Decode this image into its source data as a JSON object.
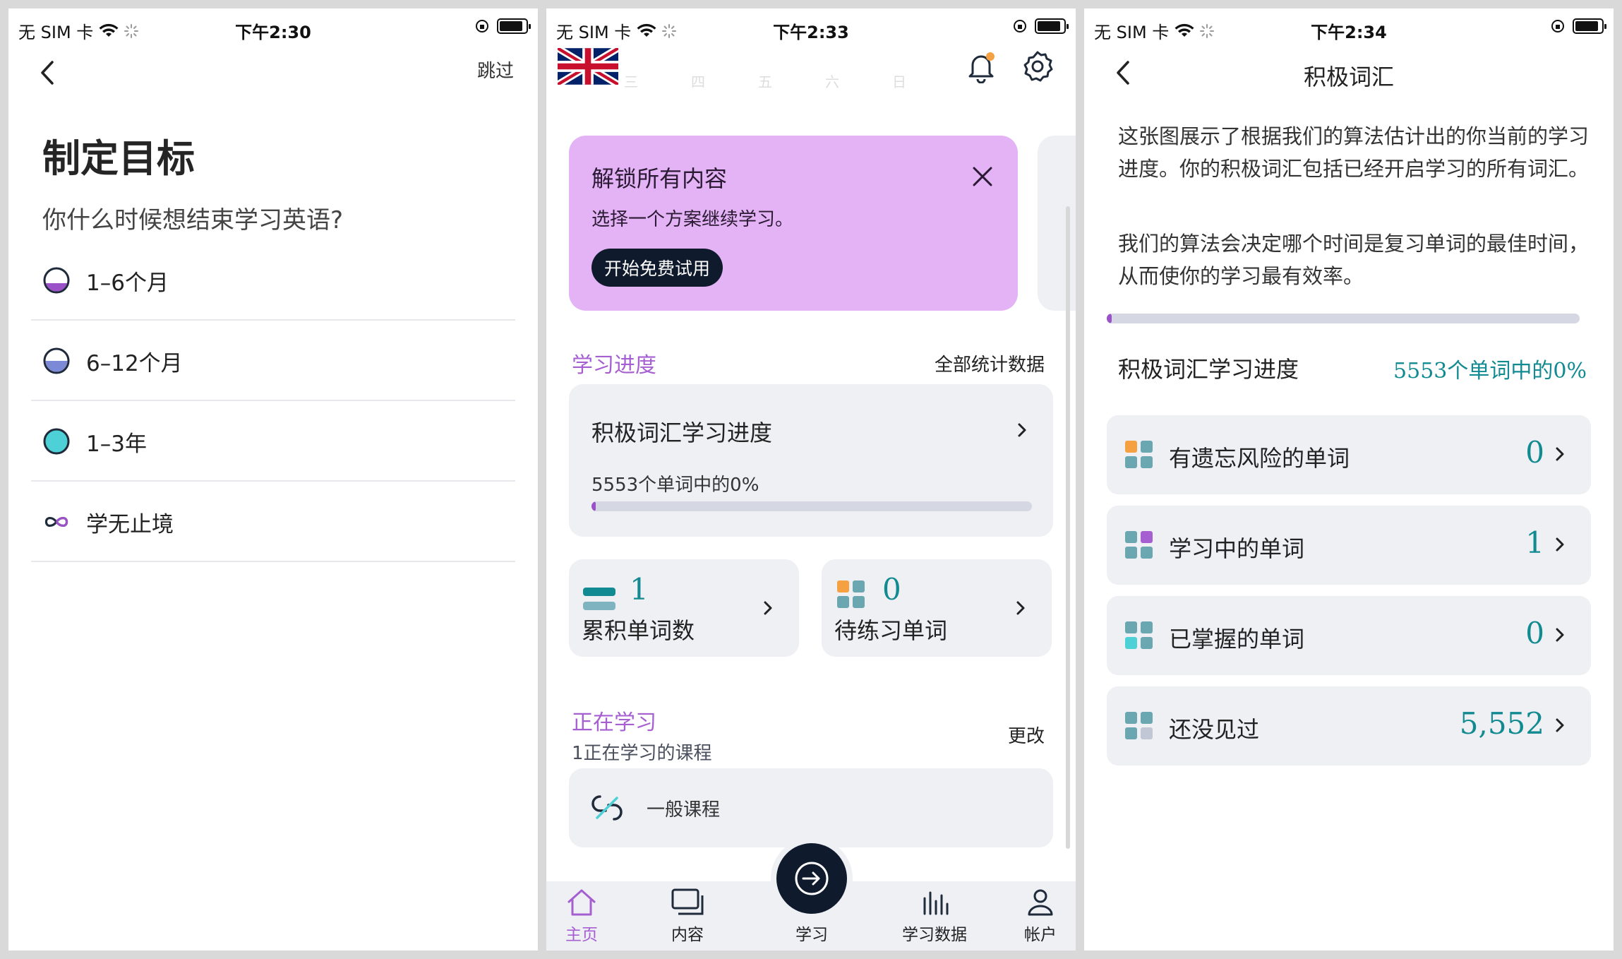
{
  "status": {
    "carrier": "无 SIM 卡",
    "time1": "下午2:30",
    "time2": "下午2:33",
    "time3": "下午2:34"
  },
  "goal": {
    "skip": "跳过",
    "title": "制定目标",
    "question": "你什么时候想结束学习英语?",
    "options": [
      {
        "label": "1–6个月",
        "icon": "quarter-fill-icon"
      },
      {
        "label": "6–12个月",
        "icon": "half-fill-icon"
      },
      {
        "label": "1–3年",
        "icon": "full-fill-icon"
      },
      {
        "label": "学无止境",
        "icon": "infinity-icon"
      }
    ]
  },
  "home": {
    "weekdays": [
      "三",
      "四",
      "五",
      "六",
      "日"
    ],
    "promo": {
      "title": "解锁所有内容",
      "subtitle": "选择一个方案继续学习。",
      "button": "开始免费试用"
    },
    "progress_section": {
      "title": "学习进度",
      "link": "全部统计数据"
    },
    "vocab_card": {
      "title": "积极词汇学习进度",
      "subtitle": "5553个单词中的0%",
      "progress": 0.005
    },
    "stat_total": {
      "value": "1",
      "label": "累积单词数"
    },
    "stat_practice": {
      "value": "0",
      "label": "待练习单词"
    },
    "learning_section": {
      "title": "正在学习",
      "subtitle": "1正在学习的课程",
      "link": "更改"
    },
    "course": {
      "label": "一般课程"
    },
    "tabs": [
      {
        "label": "主页",
        "icon": "home-icon",
        "active": true
      },
      {
        "label": "内容",
        "icon": "cards-icon",
        "active": false
      },
      {
        "label": "学习",
        "icon": "arrow-circle-icon",
        "active": false
      },
      {
        "label": "学习数据",
        "icon": "bars-icon",
        "active": false
      },
      {
        "label": "帐户",
        "icon": "user-icon",
        "active": false
      }
    ],
    "colors": {
      "accent": "#a65fd1",
      "teal": "#128a91",
      "dark": "#0f1a2c",
      "promo": "#e4b3f5"
    }
  },
  "vocab": {
    "title": "积极词汇",
    "para1": "这张图展示了根据我们的算法估计出的你当前的学习进度。你的积极词汇包括已经开启学习的所有词汇。",
    "para2": "我们的算法会决定哪个时间是复习单词的最佳时间，从而使你的学习最有效率。",
    "progress_label": "积极词汇学习进度",
    "progress_value": "5553个单词中的0%",
    "progress": 0.005,
    "rows": [
      {
        "label": "有遗忘风险的单词",
        "value": "0"
      },
      {
        "label": "学习中的单词",
        "value": "1"
      },
      {
        "label": "已掌握的单词",
        "value": "0"
      },
      {
        "label": "还没见过",
        "value": "5,552"
      }
    ]
  }
}
